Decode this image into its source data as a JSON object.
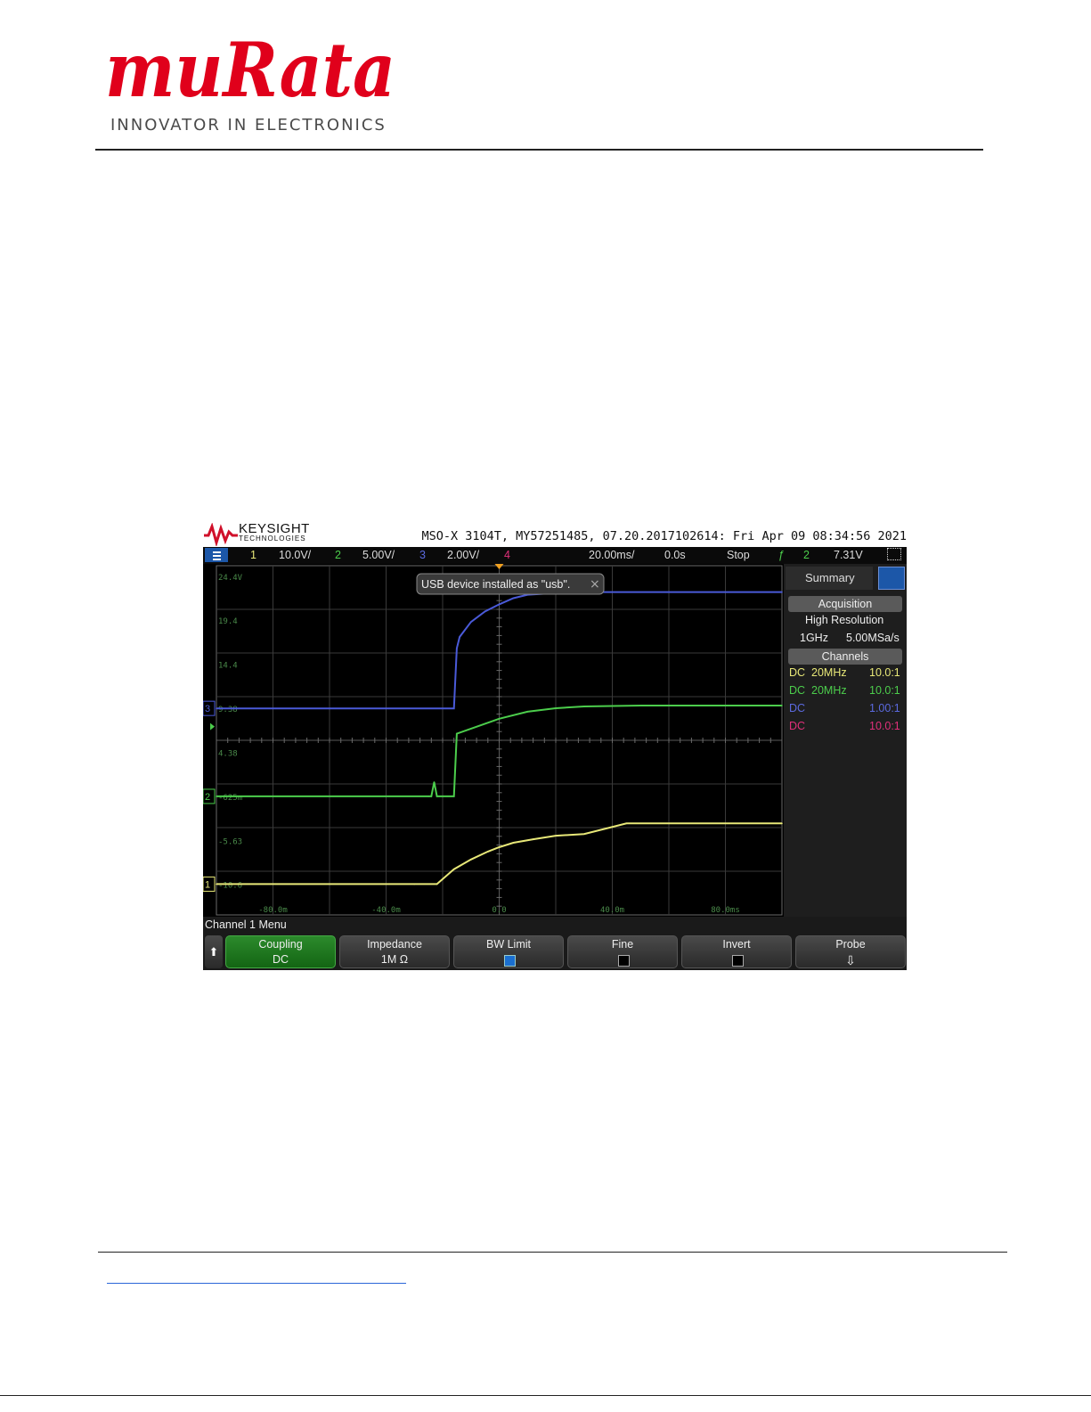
{
  "header": {
    "logo_text": "muRata",
    "tagline": "INNOVATOR IN ELECTRONICS",
    "brand_color": "#e0001b"
  },
  "scope": {
    "vendor": "KEYSIGHT",
    "vendor_sub": "TECHNOLOGIES",
    "id_line": "MSO-X 3104T, MY57251485, 07.20.2017102614: Fri Apr 09 08:34:56 2021",
    "status": {
      "ch1": "1",
      "ch1_scale": "10.0V/",
      "ch2": "2",
      "ch2_scale": "5.00V/",
      "ch3": "3",
      "ch3_scale": "2.00V/",
      "ch4": "4",
      "timebase": "20.00ms/",
      "delay": "0.0s",
      "run_state": "Stop",
      "trig_ch": "2",
      "trig_level": "7.31V"
    },
    "notification": "USB device installed as \"usb\".",
    "y_labels": [
      "24.4V",
      "19.4",
      "14.4",
      "9.38",
      "4.38",
      "-625m",
      "-5.63",
      "-10.6"
    ],
    "x_labels": [
      "-80.0m",
      "-40.0m",
      "0.0",
      "40.0m",
      "80.0ms"
    ],
    "marker_ch1": "1",
    "marker_ch2": "2",
    "marker_ch3": "3",
    "colors": {
      "ch1": "#e8e878",
      "ch2": "#4ccd4c",
      "ch3": "#4a5ad8",
      "ch4": "#e0307a"
    },
    "side": {
      "tab": "Summary",
      "acquisition_hdr": "Acquisition",
      "mode": "High Resolution",
      "bw": "1GHz",
      "rate": "5.00MSa/s",
      "channels_hdr": "Channels",
      "rows": [
        {
          "coupling": "DC",
          "bw": "20MHz",
          "probe": "10.0:1"
        },
        {
          "coupling": "DC",
          "bw": "20MHz",
          "probe": "10.0:1"
        },
        {
          "coupling": "DC",
          "bw": "",
          "probe": "1.00:1"
        },
        {
          "coupling": "DC",
          "bw": "",
          "probe": "10.0:1"
        }
      ]
    },
    "menu_title": "Channel 1 Menu",
    "softkeys": {
      "coupling": "Coupling",
      "coupling_val": "DC",
      "impedance": "Impedance",
      "impedance_val": "1M Ω",
      "bw_limit": "BW Limit",
      "bw_limit_on": true,
      "fine": "Fine",
      "fine_on": false,
      "invert": "Invert",
      "invert_on": false,
      "probe": "Probe"
    }
  },
  "chart_data": {
    "type": "line",
    "xlabel": "",
    "ylabel": "",
    "xlim": [
      -100,
      100
    ],
    "ylim": [
      -14.1,
      25.6
    ],
    "series": [
      {
        "x": [
          -100,
          -30,
          -22,
          -16,
          -10,
          -4,
          0,
          5,
          12,
          20,
          30,
          45,
          100
        ],
        "y": [
          -10.6,
          -10.6,
          -10.6,
          -8.9,
          -7.8,
          -6.9,
          -6.4,
          -5.9,
          -5.5,
          -5.1,
          -4.9,
          -3.7,
          -3.7
        ]
      },
      {
        "x": [
          -100,
          -25,
          -24,
          -23,
          -22,
          -16,
          -15,
          0,
          10,
          20,
          30,
          50,
          100
        ],
        "y": [
          -0.625,
          -0.625,
          -0.625,
          1.0,
          -0.625,
          -0.625,
          6.5,
          8.2,
          9.0,
          9.4,
          9.6,
          9.7,
          9.7
        ]
      },
      {
        "x": [
          -100,
          -16,
          -15,
          -14,
          -10,
          -5,
          0,
          5,
          10,
          20,
          30,
          60,
          100
        ],
        "y": [
          9.38,
          9.38,
          16.2,
          17.5,
          19.2,
          20.4,
          21.2,
          21.9,
          22.3,
          22.5,
          22.6,
          22.6,
          22.6
        ]
      }
    ]
  }
}
